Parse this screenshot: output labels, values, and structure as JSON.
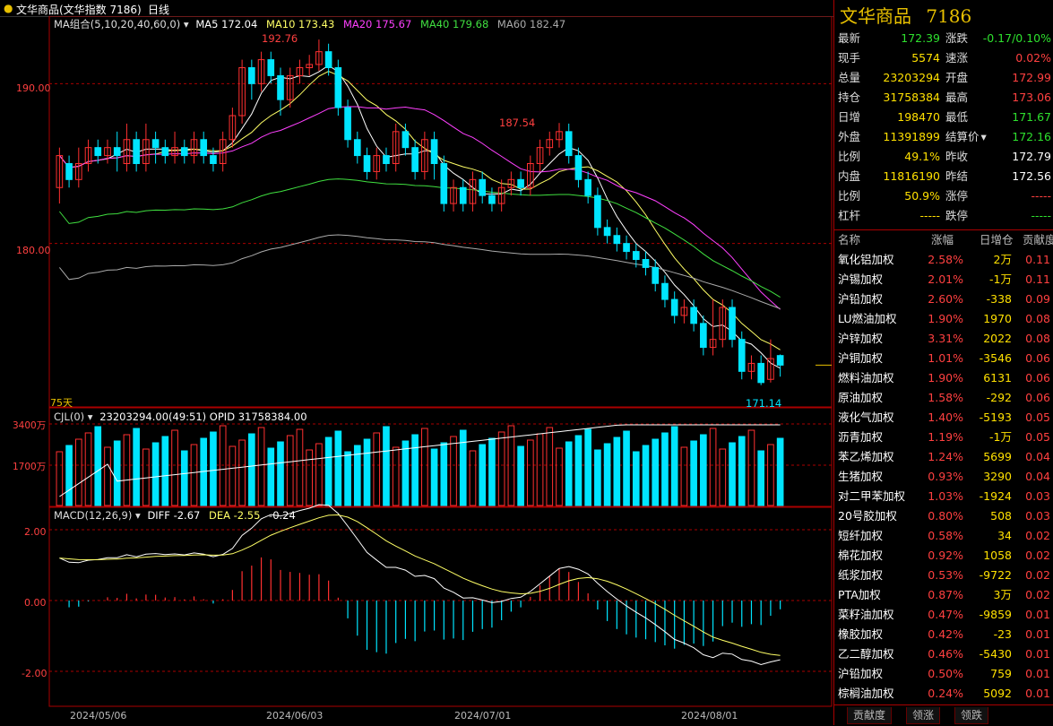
{
  "header": {
    "title": "文华商品(文华指数 7186)",
    "period": "日线"
  },
  "indicators": {
    "ma_label": "MA组合(5,10,20,40,60,0)",
    "ma5": "MA5 172.04",
    "ma10": "MA10 173.43",
    "ma20": "MA20 175.67",
    "ma40": "MA40 179.68",
    "ma60": "MA60 182.47",
    "high_label": "192.76",
    "mid_high_label": "187.54",
    "low_label": "171.14",
    "days_label": "75天",
    "cjl_label": "CJL(0)",
    "cjl_values": "23203294.00(49:51)  OPID 31758384.00",
    "macd_label": "MACD(12,26,9)",
    "diff": "DIFF -2.67",
    "dea": "DEA -2.55",
    "macd": "-0.24"
  },
  "axes": {
    "price_ticks": [
      "190.00",
      "180.00"
    ],
    "vol_ticks": [
      "3400万",
      "1700万"
    ],
    "macd_ticks": [
      "2.00",
      "0.00",
      "-2.00"
    ],
    "dates": [
      "2024/05/06",
      "2024/06/03",
      "2024/07/01",
      "2024/08/01"
    ]
  },
  "quote": {
    "title": "文华商品",
    "code": "7186",
    "left": [
      {
        "label": "最新",
        "value": "172.39",
        "color": "green"
      },
      {
        "label": "现手",
        "value": "5574",
        "color": "yellow"
      },
      {
        "label": "总量",
        "value": "23203294",
        "color": "yellow"
      },
      {
        "label": "持仓",
        "value": "31758384",
        "color": "yellow"
      },
      {
        "label": "日增",
        "value": "198470",
        "color": "yellow"
      },
      {
        "label": "外盘",
        "value": "11391899",
        "color": "yellow"
      },
      {
        "label": "比例",
        "value": "49.1%",
        "color": "yellow"
      },
      {
        "label": "内盘",
        "value": "11816190",
        "color": "yellow"
      },
      {
        "label": "比例",
        "value": "50.9%",
        "color": "yellow"
      },
      {
        "label": "杠杆",
        "value": "-----",
        "color": "yellow"
      }
    ],
    "right": [
      {
        "label": "涨跌",
        "value": "-0.17/0.10%",
        "color": "green"
      },
      {
        "label": "速涨",
        "value": "0.02%",
        "color": "red"
      },
      {
        "label": "开盘",
        "value": "172.99",
        "color": "red"
      },
      {
        "label": "最高",
        "value": "173.06",
        "color": "red"
      },
      {
        "label": "最低",
        "value": "171.67",
        "color": "green"
      },
      {
        "label": "结算价",
        "value": "172.16",
        "color": "green"
      },
      {
        "label": "昨收",
        "value": "172.79",
        "color": "white"
      },
      {
        "label": "昨结",
        "value": "172.56",
        "color": "white"
      },
      {
        "label": "涨停",
        "value": "-----",
        "color": "red"
      },
      {
        "label": "跌停",
        "value": "-----",
        "color": "green"
      }
    ]
  },
  "list": {
    "headers": [
      "名称",
      "涨幅",
      "日增仓",
      "贡献度"
    ],
    "rows": [
      [
        "氧化铝加权",
        "2.58%",
        "2万",
        "0.11"
      ],
      [
        "沪锡加权",
        "2.01%",
        "-1万",
        "0.11"
      ],
      [
        "沪铅加权",
        "2.60%",
        "-338",
        "0.09"
      ],
      [
        "LU燃油加权",
        "1.90%",
        "1970",
        "0.08"
      ],
      [
        "沪锌加权",
        "3.31%",
        "2022",
        "0.08"
      ],
      [
        "沪铜加权",
        "1.01%",
        "-3546",
        "0.06"
      ],
      [
        "燃料油加权",
        "1.90%",
        "6131",
        "0.06"
      ],
      [
        "原油加权",
        "1.58%",
        "-292",
        "0.06"
      ],
      [
        "液化气加权",
        "1.40%",
        "-5193",
        "0.05"
      ],
      [
        "沥青加权",
        "1.19%",
        "-1万",
        "0.05"
      ],
      [
        "苯乙烯加权",
        "1.24%",
        "5699",
        "0.04"
      ],
      [
        "生猪加权",
        "0.93%",
        "3290",
        "0.04"
      ],
      [
        "对二甲苯加权",
        "1.03%",
        "-1924",
        "0.03"
      ],
      [
        "20号胶加权",
        "0.80%",
        "508",
        "0.03"
      ],
      [
        "短纤加权",
        "0.58%",
        "34",
        "0.02"
      ],
      [
        "棉花加权",
        "0.92%",
        "1058",
        "0.02"
      ],
      [
        "纸浆加权",
        "0.53%",
        "-9722",
        "0.02"
      ],
      [
        "PTA加权",
        "0.87%",
        "3万",
        "0.02"
      ],
      [
        "菜籽油加权",
        "0.47%",
        "-9859",
        "0.01"
      ],
      [
        "橡胶加权",
        "0.42%",
        "-23",
        "0.01"
      ],
      [
        "乙二醇加权",
        "0.46%",
        "-5430",
        "0.01"
      ],
      [
        "沪铅加权",
        "0.50%",
        "759",
        "0.01"
      ],
      [
        "棕榈油加权",
        "0.24%",
        "5092",
        "0.01"
      ]
    ]
  },
  "tabs": [
    "贡献度",
    "领涨",
    "领跌"
  ],
  "chart_data": {
    "type": "candlestick",
    "ylim": [
      170,
      194
    ],
    "candles": [
      [
        183.5,
        185.5,
        182.5,
        186.0
      ],
      [
        185.0,
        184.0,
        183.5,
        185.5
      ],
      [
        184.0,
        185.0,
        183.5,
        186.0
      ],
      [
        185.0,
        186.0,
        184.5,
        186.5
      ],
      [
        186.0,
        185.5,
        185.0,
        186.5
      ],
      [
        185.5,
        186.0,
        185.0,
        186.5
      ],
      [
        186.0,
        185.5,
        184.5,
        187.0
      ],
      [
        185.0,
        186.5,
        184.5,
        187.5
      ],
      [
        186.5,
        185.0,
        184.5,
        187.0
      ],
      [
        185.0,
        186.5,
        184.5,
        187.5
      ],
      [
        186.5,
        186.0,
        185.0,
        187.0
      ],
      [
        186.0,
        185.5,
        185.0,
        186.5
      ],
      [
        185.5,
        186.0,
        185.0,
        187.0
      ],
      [
        186.0,
        185.5,
        185.0,
        186.5
      ],
      [
        185.5,
        186.5,
        185.0,
        187.0
      ],
      [
        186.5,
        185.5,
        185.0,
        187.0
      ],
      [
        185.5,
        185.0,
        184.5,
        186.0
      ],
      [
        185.0,
        186.5,
        184.5,
        187.0
      ],
      [
        186.5,
        188.0,
        186.0,
        188.5
      ],
      [
        188.0,
        191.0,
        187.5,
        191.5
      ],
      [
        191.0,
        190.0,
        189.0,
        191.5
      ],
      [
        190.0,
        191.5,
        189.5,
        192.0
      ],
      [
        191.5,
        190.5,
        190.0,
        192.0
      ],
      [
        190.5,
        189.0,
        188.0,
        191.0
      ],
      [
        189.0,
        190.5,
        188.5,
        191.0
      ],
      [
        190.5,
        191.0,
        190.0,
        191.5
      ],
      [
        191.0,
        191.2,
        190.5,
        191.8
      ],
      [
        191.2,
        192.0,
        190.8,
        192.76
      ],
      [
        192.0,
        191.0,
        190.5,
        192.5
      ],
      [
        191.0,
        188.5,
        188.0,
        191.5
      ],
      [
        188.5,
        186.5,
        186.0,
        189.0
      ],
      [
        186.5,
        185.5,
        185.0,
        187.0
      ],
      [
        185.5,
        184.5,
        184.0,
        186.0
      ],
      [
        184.5,
        185.5,
        184.0,
        186.0
      ],
      [
        185.5,
        185.0,
        184.5,
        186.0
      ],
      [
        185.0,
        187.0,
        184.5,
        187.5
      ],
      [
        187.0,
        186.0,
        185.5,
        187.5
      ],
      [
        186.0,
        184.5,
        184.0,
        186.5
      ],
      [
        184.5,
        186.5,
        184.0,
        187.0
      ],
      [
        186.5,
        185.0,
        184.0,
        187.0
      ],
      [
        185.0,
        182.5,
        182.0,
        185.5
      ],
      [
        182.5,
        183.5,
        182.0,
        184.0
      ],
      [
        183.5,
        182.5,
        182.0,
        184.0
      ],
      [
        182.5,
        184.0,
        182.0,
        184.5
      ],
      [
        184.0,
        183.0,
        182.5,
        184.5
      ],
      [
        183.0,
        182.5,
        182.0,
        183.5
      ],
      [
        182.5,
        183.5,
        182.0,
        184.0
      ],
      [
        183.5,
        184.0,
        183.0,
        184.5
      ],
      [
        184.0,
        183.5,
        183.0,
        184.5
      ],
      [
        183.5,
        185.0,
        183.0,
        185.5
      ],
      [
        185.0,
        186.0,
        184.5,
        186.5
      ],
      [
        186.0,
        186.5,
        185.5,
        187.0
      ],
      [
        186.5,
        187.0,
        186.0,
        187.54
      ],
      [
        187.0,
        185.5,
        185.0,
        187.5
      ],
      [
        185.5,
        184.0,
        183.5,
        186.0
      ],
      [
        184.0,
        183.0,
        182.5,
        184.5
      ],
      [
        183.0,
        181.0,
        180.5,
        183.5
      ],
      [
        181.0,
        180.5,
        180.0,
        181.5
      ],
      [
        180.5,
        180.0,
        179.5,
        181.0
      ],
      [
        180.0,
        179.5,
        179.0,
        180.5
      ],
      [
        179.5,
        179.0,
        178.5,
        180.0
      ],
      [
        179.0,
        178.5,
        178.0,
        179.5
      ],
      [
        178.5,
        177.5,
        177.0,
        179.0
      ],
      [
        177.5,
        176.5,
        176.0,
        178.0
      ],
      [
        176.5,
        175.5,
        175.0,
        177.0
      ],
      [
        175.5,
        176.0,
        175.0,
        176.5
      ],
      [
        176.0,
        175.0,
        174.5,
        176.5
      ],
      [
        175.0,
        173.5,
        173.0,
        175.5
      ],
      [
        173.5,
        174.0,
        173.0,
        176.5
      ],
      [
        174.0,
        176.0,
        173.5,
        176.5
      ],
      [
        176.0,
        174.0,
        173.5,
        176.5
      ],
      [
        174.0,
        172.0,
        171.5,
        174.5
      ],
      [
        172.0,
        172.5,
        171.5,
        173.0
      ],
      [
        172.5,
        171.3,
        171.14,
        173.0
      ],
      [
        171.5,
        172.8,
        171.3,
        174.0
      ],
      [
        172.99,
        172.39,
        171.67,
        173.06
      ]
    ]
  },
  "colors": {
    "up": "#ff3030",
    "down": "#00e5ff",
    "ma5": "#ffffff",
    "ma10": "#ffff66",
    "ma20": "#ff40ff",
    "ma40": "#40e040",
    "ma60": "#aaaaaa",
    "frame": "#aa0000"
  }
}
